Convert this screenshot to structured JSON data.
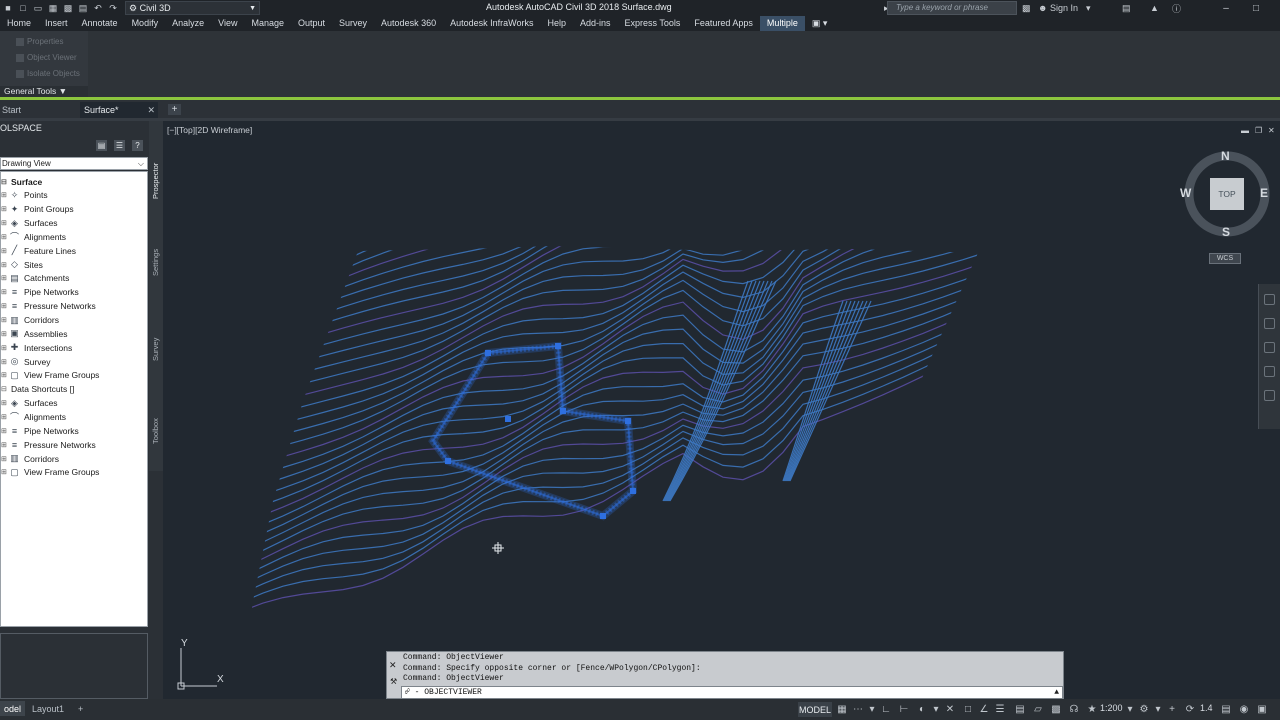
{
  "titlebar": {
    "workspace": "Civil 3D",
    "app_title": "Autodesk AutoCAD Civil 3D 2018    Surface.dwg",
    "search_placeholder": "Type a keyword or phrase",
    "sign_in": "Sign In"
  },
  "menu": {
    "items": [
      "Home",
      "Insert",
      "Annotate",
      "Modify",
      "Analyze",
      "View",
      "Manage",
      "Output",
      "Survey",
      "Autodesk 360",
      "Autodesk InfraWorks",
      "Help",
      "Add-ins",
      "Express Tools",
      "Featured Apps",
      "Multiple"
    ],
    "active_index": 15
  },
  "ribbon": {
    "items": [
      "Properties",
      "Object Viewer",
      "Isolate Objects"
    ],
    "panel_title": "General Tools"
  },
  "doc_tabs": {
    "start": "Start",
    "active": "Surface*"
  },
  "toolspace": {
    "title": "OLSPACE",
    "view_dropdown": "Drawing View",
    "tree": [
      {
        "label": "Surface",
        "bold": true,
        "indent": 0,
        "icon": "drawing-icon"
      },
      {
        "label": "Points",
        "indent": 1,
        "icon": "points-icon"
      },
      {
        "label": "Point Groups",
        "indent": 1,
        "icon": "point-groups-icon"
      },
      {
        "label": "Surfaces",
        "indent": 1,
        "icon": "surfaces-icon"
      },
      {
        "label": "Alignments",
        "indent": 1,
        "icon": "alignments-icon"
      },
      {
        "label": "Feature Lines",
        "indent": 1,
        "icon": "feature-lines-icon"
      },
      {
        "label": "Sites",
        "indent": 1,
        "icon": "sites-icon"
      },
      {
        "label": "Catchments",
        "indent": 1,
        "icon": "catchments-icon"
      },
      {
        "label": "Pipe Networks",
        "indent": 1,
        "icon": "pipe-networks-icon"
      },
      {
        "label": "Pressure Networks",
        "indent": 1,
        "icon": "pressure-networks-icon"
      },
      {
        "label": "Corridors",
        "indent": 1,
        "icon": "corridors-icon"
      },
      {
        "label": "Assemblies",
        "indent": 1,
        "icon": "assemblies-icon"
      },
      {
        "label": "Intersections",
        "indent": 1,
        "icon": "intersections-icon"
      },
      {
        "label": "Survey",
        "indent": 1,
        "icon": "survey-icon"
      },
      {
        "label": "View Frame Groups",
        "indent": 1,
        "icon": "view-frame-groups-icon"
      },
      {
        "label": "Data Shortcuts []",
        "indent": 0,
        "icon": "data-shortcuts-icon"
      },
      {
        "label": "Surfaces",
        "indent": 1,
        "icon": "surfaces-icon"
      },
      {
        "label": "Alignments",
        "indent": 1,
        "icon": "alignments-icon"
      },
      {
        "label": "Pipe Networks",
        "indent": 1,
        "icon": "pipe-networks-icon"
      },
      {
        "label": "Pressure Networks",
        "indent": 1,
        "icon": "pressure-networks-icon"
      },
      {
        "label": "Corridors",
        "indent": 1,
        "icon": "corridors-icon"
      },
      {
        "label": "View Frame Groups",
        "indent": 1,
        "icon": "view-frame-groups-icon"
      }
    ],
    "vtabs": [
      "Prospector",
      "Settings",
      "Survey",
      "Toolbox"
    ]
  },
  "viewport": {
    "label": "[−][Top][2D Wireframe]",
    "viewcube": {
      "n": "N",
      "s": "S",
      "e": "E",
      "w": "W",
      "top": "TOP",
      "wcs": "WCS"
    },
    "ucs_x": "X",
    "ucs_y": "Y"
  },
  "command": {
    "history": [
      "Command: ObjectViewer",
      "Command: Specify opposite corner or [Fence/WPolygon/CPolygon]:",
      "Command: ObjectViewer"
    ],
    "input": "- OBJECTVIEWER"
  },
  "status": {
    "layout_tabs": [
      "odel",
      "Layout1"
    ],
    "model": "MODEL",
    "scale": "1:200",
    "annotation": "1.4"
  },
  "colors": {
    "contour_major": "#3d79c4",
    "contour_minor": "#5a4fa8",
    "selection": "#2e6fe0",
    "accent": "#8cc63e"
  }
}
